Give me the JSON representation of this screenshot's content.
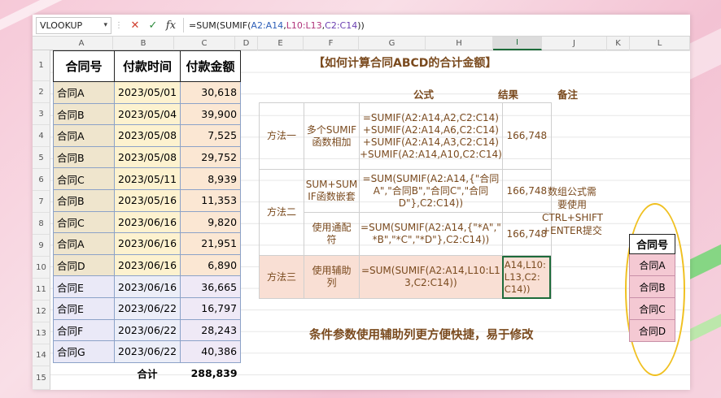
{
  "formula_bar": {
    "name_box": "VLOOKUP",
    "formula_prefix": "=SUM(SUMIF(",
    "ref1": "A2:A14",
    "comma1": ",",
    "ref2": "L10:L13",
    "comma2": ",",
    "ref3": "C2:C14",
    "suffix": "))"
  },
  "columns": [
    "A",
    "B",
    "C",
    "D",
    "E",
    "F",
    "G",
    "H",
    "I",
    "J",
    "K",
    "L"
  ],
  "rows": [
    "1",
    "2",
    "3",
    "4",
    "5",
    "6",
    "7",
    "8",
    "9",
    "10",
    "11",
    "12",
    "13",
    "14",
    "15"
  ],
  "left_table": {
    "headers": [
      "合同号",
      "付款时间",
      "付款金额"
    ],
    "rows": [
      [
        "合同A",
        "2023/05/01",
        "30,618"
      ],
      [
        "合同B",
        "2023/05/04",
        "39,900"
      ],
      [
        "合同A",
        "2023/05/08",
        "7,525"
      ],
      [
        "合同B",
        "2023/05/08",
        "29,752"
      ],
      [
        "合同C",
        "2023/05/11",
        "8,939"
      ],
      [
        "合同B",
        "2023/05/16",
        "11,353"
      ],
      [
        "合同C",
        "2023/06/16",
        "9,820"
      ],
      [
        "合同A",
        "2023/06/16",
        "21,951"
      ],
      [
        "合同D",
        "2023/06/16",
        "6,890"
      ],
      [
        "合同E",
        "2023/06/16",
        "36,665"
      ],
      [
        "合同E",
        "2023/06/22",
        "16,797"
      ],
      [
        "合同F",
        "2023/06/22",
        "28,243"
      ],
      [
        "合同G",
        "2023/06/22",
        "40,386"
      ]
    ],
    "total_label": "合计",
    "total_value": "288,839"
  },
  "title": "【如何计算合同ABCD的合计金额】",
  "headers": {
    "formula": "公式",
    "result": "结果",
    "note": "备注"
  },
  "methods": [
    {
      "name": "方法一",
      "desc": [
        "多个SUMIF",
        "函数相加"
      ],
      "formula": [
        "=SUMIF(A2:A14,A2,C2:C14)",
        "+SUMIF(A2:A14,A6,C2:C14)",
        "+SUMIF(A2:A14,A3,C2:C14)",
        "+SUMIF(A2:A14,A10,C2:C14)"
      ],
      "result": "166,748"
    },
    {
      "name": "方法二",
      "desc": [
        "SUM+SUM",
        "IF函数嵌套"
      ],
      "formula": [
        "=SUM(SUMIF(A2:A14,{\"合同",
        "A\",\"合同B\",\"合同C\",\"合同",
        "D\"},C2:C14))"
      ],
      "result": "166,748",
      "desc2": [
        "使用通配",
        "符"
      ],
      "formula2": [
        "=SUM(SUMIF(A2:A14,{\"*A\",\"",
        "*B\",\"*C\",\"*D\"},C2:C14))"
      ],
      "result2": "166,748"
    },
    {
      "name": "方法三",
      "desc": [
        "使用辅助",
        "列"
      ],
      "formula": [
        "=SUM(SUMIF(A2:A14,L10:L1",
        "3,C2:C14))"
      ],
      "result_edit": [
        "A14,L10:",
        "L13,C2:",
        "C14))"
      ]
    }
  ],
  "note": [
    "数组公式需",
    "要使用",
    "CTRL+SHIFT",
    "+ENTER提交"
  ],
  "footer": "条件参数使用辅助列更方便快捷，易于修改",
  "helper": {
    "header": "合同号",
    "items": [
      "合同A",
      "合同B",
      "合同C",
      "合同D"
    ]
  },
  "colors": {
    "accent_text": "#7a4a1e",
    "highlight_pink": "#f4c9d3",
    "oval": "#f0c020",
    "selection": "#1d6b3a"
  }
}
